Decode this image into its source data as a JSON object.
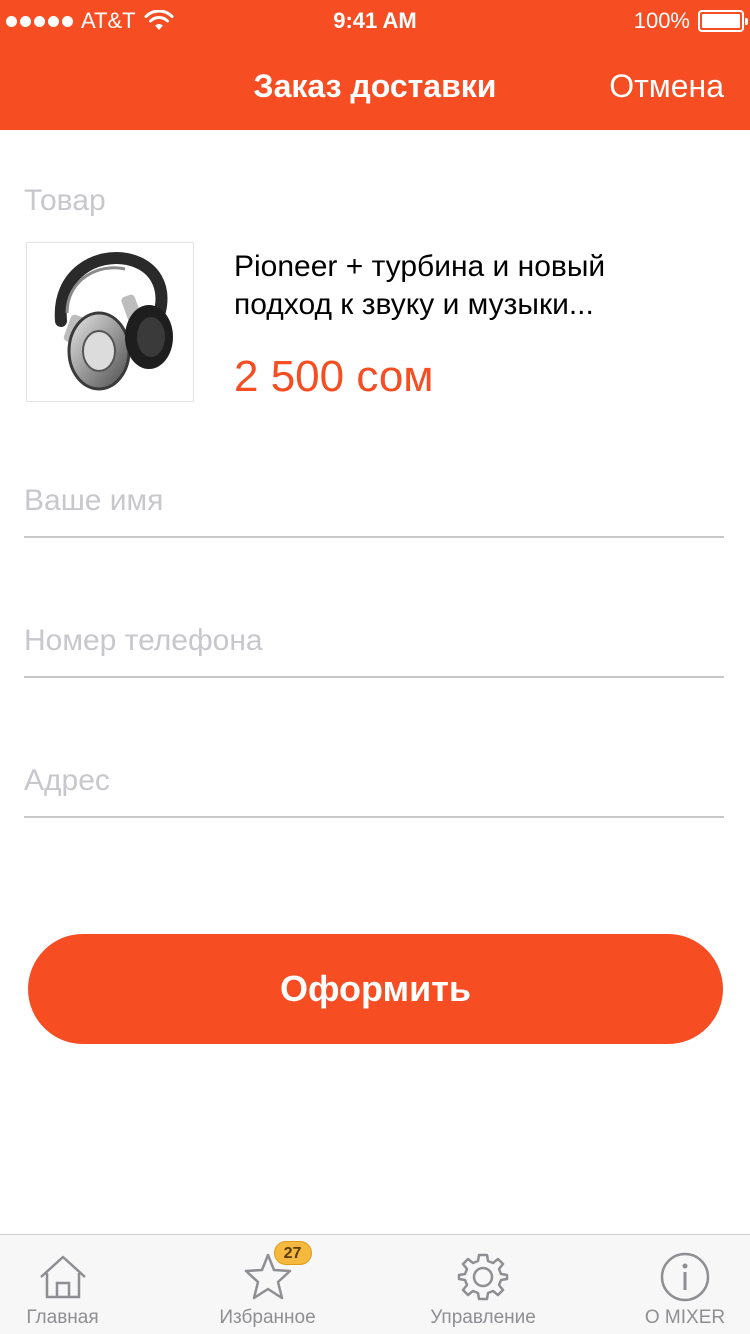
{
  "status_bar": {
    "carrier": "AT&T",
    "time": "9:41 AM",
    "battery": "100%",
    "icons": [
      "signal-dots-icon",
      "wifi-icon",
      "battery-icon"
    ]
  },
  "header": {
    "title": "Заказ доставки",
    "cancel_label": "Отмена"
  },
  "product": {
    "section_label": "Товар",
    "title": "Pioneer + турбина и новый подход к звуку и музыки...",
    "price": "2 500 сом",
    "image_icon": "headphones-image"
  },
  "form": {
    "name_placeholder": "Ваше имя",
    "phone_placeholder": "Номер телефона",
    "address_placeholder": "Адрес",
    "name_value": "",
    "phone_value": "",
    "address_value": ""
  },
  "submit": {
    "label": "Оформить"
  },
  "tabbar": {
    "items": [
      {
        "label": "Главная",
        "icon": "home-icon"
      },
      {
        "label": "Избранное",
        "icon": "star-icon",
        "badge": "27"
      },
      {
        "label": "Управление",
        "icon": "gear-icon"
      },
      {
        "label": "О MIXER",
        "icon": "info-icon"
      }
    ]
  },
  "colors": {
    "accent": "#f74d23",
    "placeholder": "#c7c7cc",
    "badge": "#f5b93f",
    "tab_inactive": "#8e8e93"
  }
}
